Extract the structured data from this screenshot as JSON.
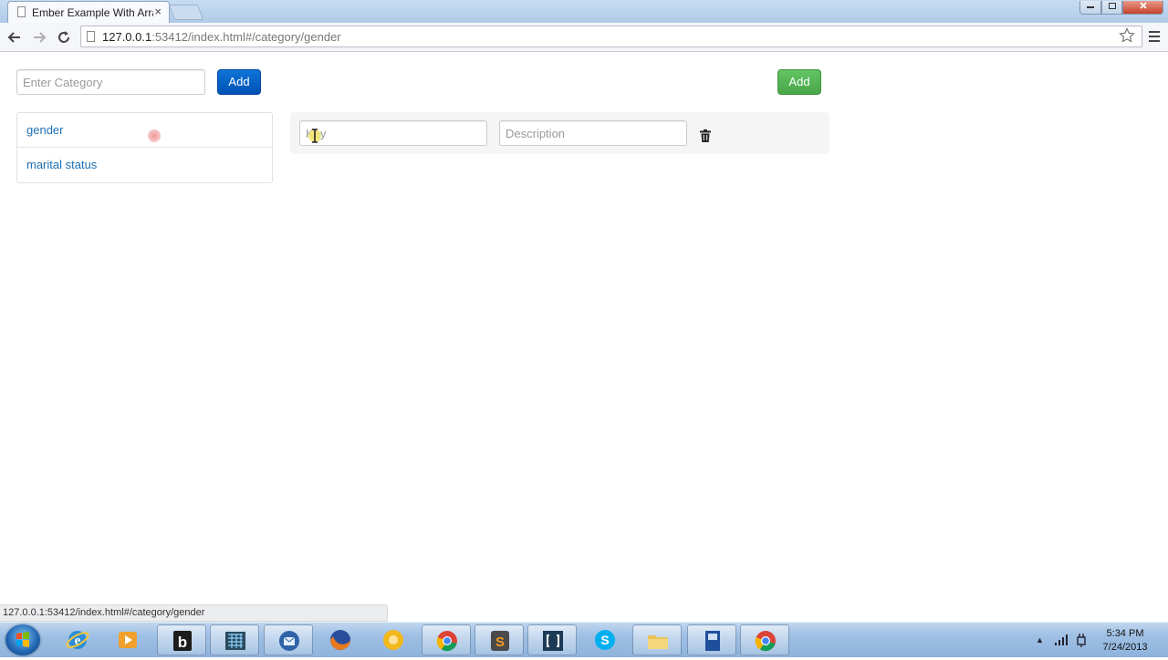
{
  "browser": {
    "tab_title": "Ember Example With Array",
    "tab_close": "×",
    "url_host": "127.0.0.1",
    "url_rest": ":53412/index.html#/category/gender",
    "status_url": "127.0.0.1:53412/index.html#/category/gender"
  },
  "page": {
    "category_input_placeholder": "Enter Category",
    "add_category_label": "Add",
    "add_item_label": "Add",
    "categories": [
      {
        "label": "gender"
      },
      {
        "label": "marital status"
      }
    ],
    "item_row": {
      "key_placeholder": "Key",
      "description_placeholder": "Description"
    }
  },
  "taskbar": {
    "time": "5:34 PM",
    "date": "7/24/2013",
    "apps": [
      "internet-explorer",
      "media-player",
      "fiddler",
      "app-grid",
      "thunderbird",
      "firefox",
      "norton",
      "chrome",
      "sublime-text",
      "brackets",
      "skype",
      "file-explorer",
      "film-editor",
      "chrome-active"
    ]
  },
  "colors": {
    "primary_button": "#0051b5",
    "success_button": "#4aa64a",
    "link": "#1f6fb2"
  }
}
